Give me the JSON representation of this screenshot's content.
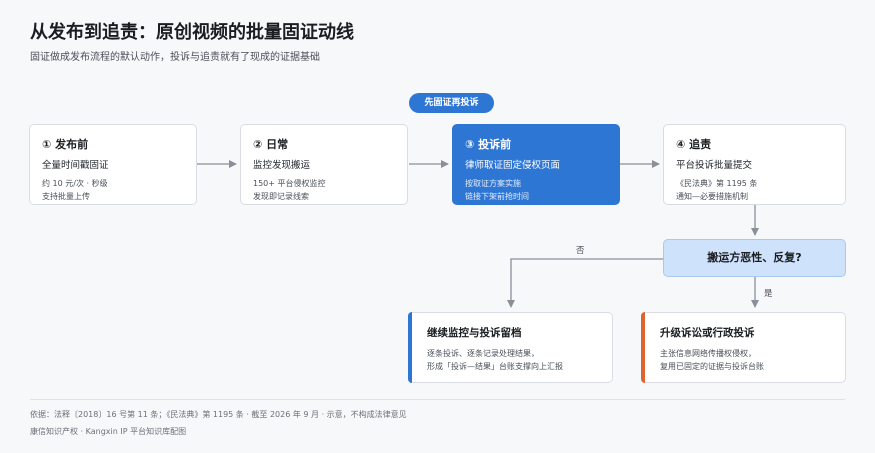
{
  "title": "从发布到追责：原创视频的批量固证动线",
  "subtitle": "固证做成发布流程的默认动作，投诉与追责就有了现成的证据基础",
  "pill_label": "先固证再投诉",
  "steps": [
    {
      "heading": "① 发布前",
      "summary": "全量时间戳固证",
      "detail1": "约 10 元/次 · 秒级",
      "detail2": "支持批量上传"
    },
    {
      "heading": "② 日常",
      "summary": "监控发现搬运",
      "detail1": "150+ 平台侵权监控",
      "detail2": "发现即记录线索"
    },
    {
      "heading": "③ 投诉前",
      "summary": "律师取证固定侵权页面",
      "detail1": "按取证方案实施",
      "detail2": "链接下架前抢时间"
    },
    {
      "heading": "④ 追责",
      "summary": "平台投诉批量提交",
      "detail1": "《民法典》第 1195 条",
      "detail2": "通知—必要措施机制"
    }
  ],
  "decision": "搬运方恶性、反复?",
  "branch_no": "否",
  "branch_yes": "是",
  "outcomes": [
    {
      "heading": "继续监控与投诉留档",
      "detail1": "逐条投诉、逐条记录处理结果，",
      "detail2": "形成「投诉—结果」台账支撑向上汇报",
      "accent": "#2e76d3"
    },
    {
      "heading": "升级诉讼或行政投诉",
      "detail1": "主张信息网络传播权侵权，",
      "detail2": "复用已固定的证据与投诉台账",
      "accent": "#e0622f"
    }
  ],
  "footer": {
    "line1": "依据：法释〔2018〕16 号第 11 条；《民法典》第 1195 条 · 截至 2026 年 9 月 · 示意，不构成法律意见",
    "line2": "康信知识产权 · Kangxin IP 平台知识库配图"
  },
  "colors": {
    "primary": "#2e76d3",
    "warning": "#e0622f",
    "decision_fill": "#cfe2fb",
    "connector": "#8a9099"
  }
}
